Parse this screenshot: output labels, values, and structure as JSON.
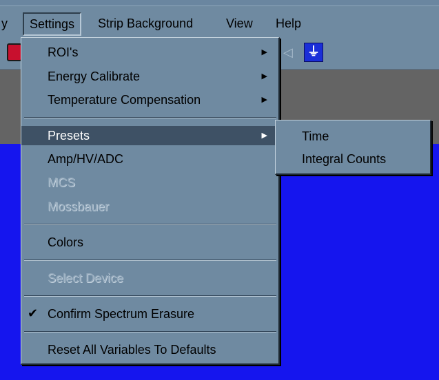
{
  "menubar": {
    "items": [
      {
        "label": "y"
      },
      {
        "label": "Settings"
      },
      {
        "label": "Strip Background"
      },
      {
        "label": "View"
      },
      {
        "label": "Help"
      }
    ]
  },
  "toolbar": {
    "logo_glyph": "⏚",
    "arrow_glyph": "◁"
  },
  "settings_menu": {
    "items": [
      {
        "label": "ROI's",
        "submenu": true,
        "enabled": true
      },
      {
        "label": "Energy Calibrate",
        "submenu": true,
        "enabled": true
      },
      {
        "label": "Temperature Compensation",
        "submenu": true,
        "enabled": true
      },
      {
        "label": "Presets",
        "submenu": true,
        "enabled": true,
        "highlighted": true
      },
      {
        "label": "Amp/HV/ADC",
        "enabled": true
      },
      {
        "label": "MCS",
        "enabled": false
      },
      {
        "label": "Mossbauer",
        "enabled": false
      },
      {
        "label": "Colors",
        "enabled": true
      },
      {
        "label": "Select Device",
        "enabled": false
      },
      {
        "label": "Confirm Spectrum Erasure",
        "enabled": true,
        "checked": true
      },
      {
        "label": "Reset All Variables To Defaults",
        "enabled": true
      }
    ],
    "check_glyph": "✔",
    "arrow_glyph": "▶"
  },
  "presets_submenu": {
    "items": [
      {
        "label": "Time"
      },
      {
        "label": "Integral Counts"
      }
    ]
  },
  "colors": {
    "chrome": "#6f8aa1",
    "highlight": "#3e5165",
    "work_area": "#1515ee",
    "band": "#646464"
  }
}
